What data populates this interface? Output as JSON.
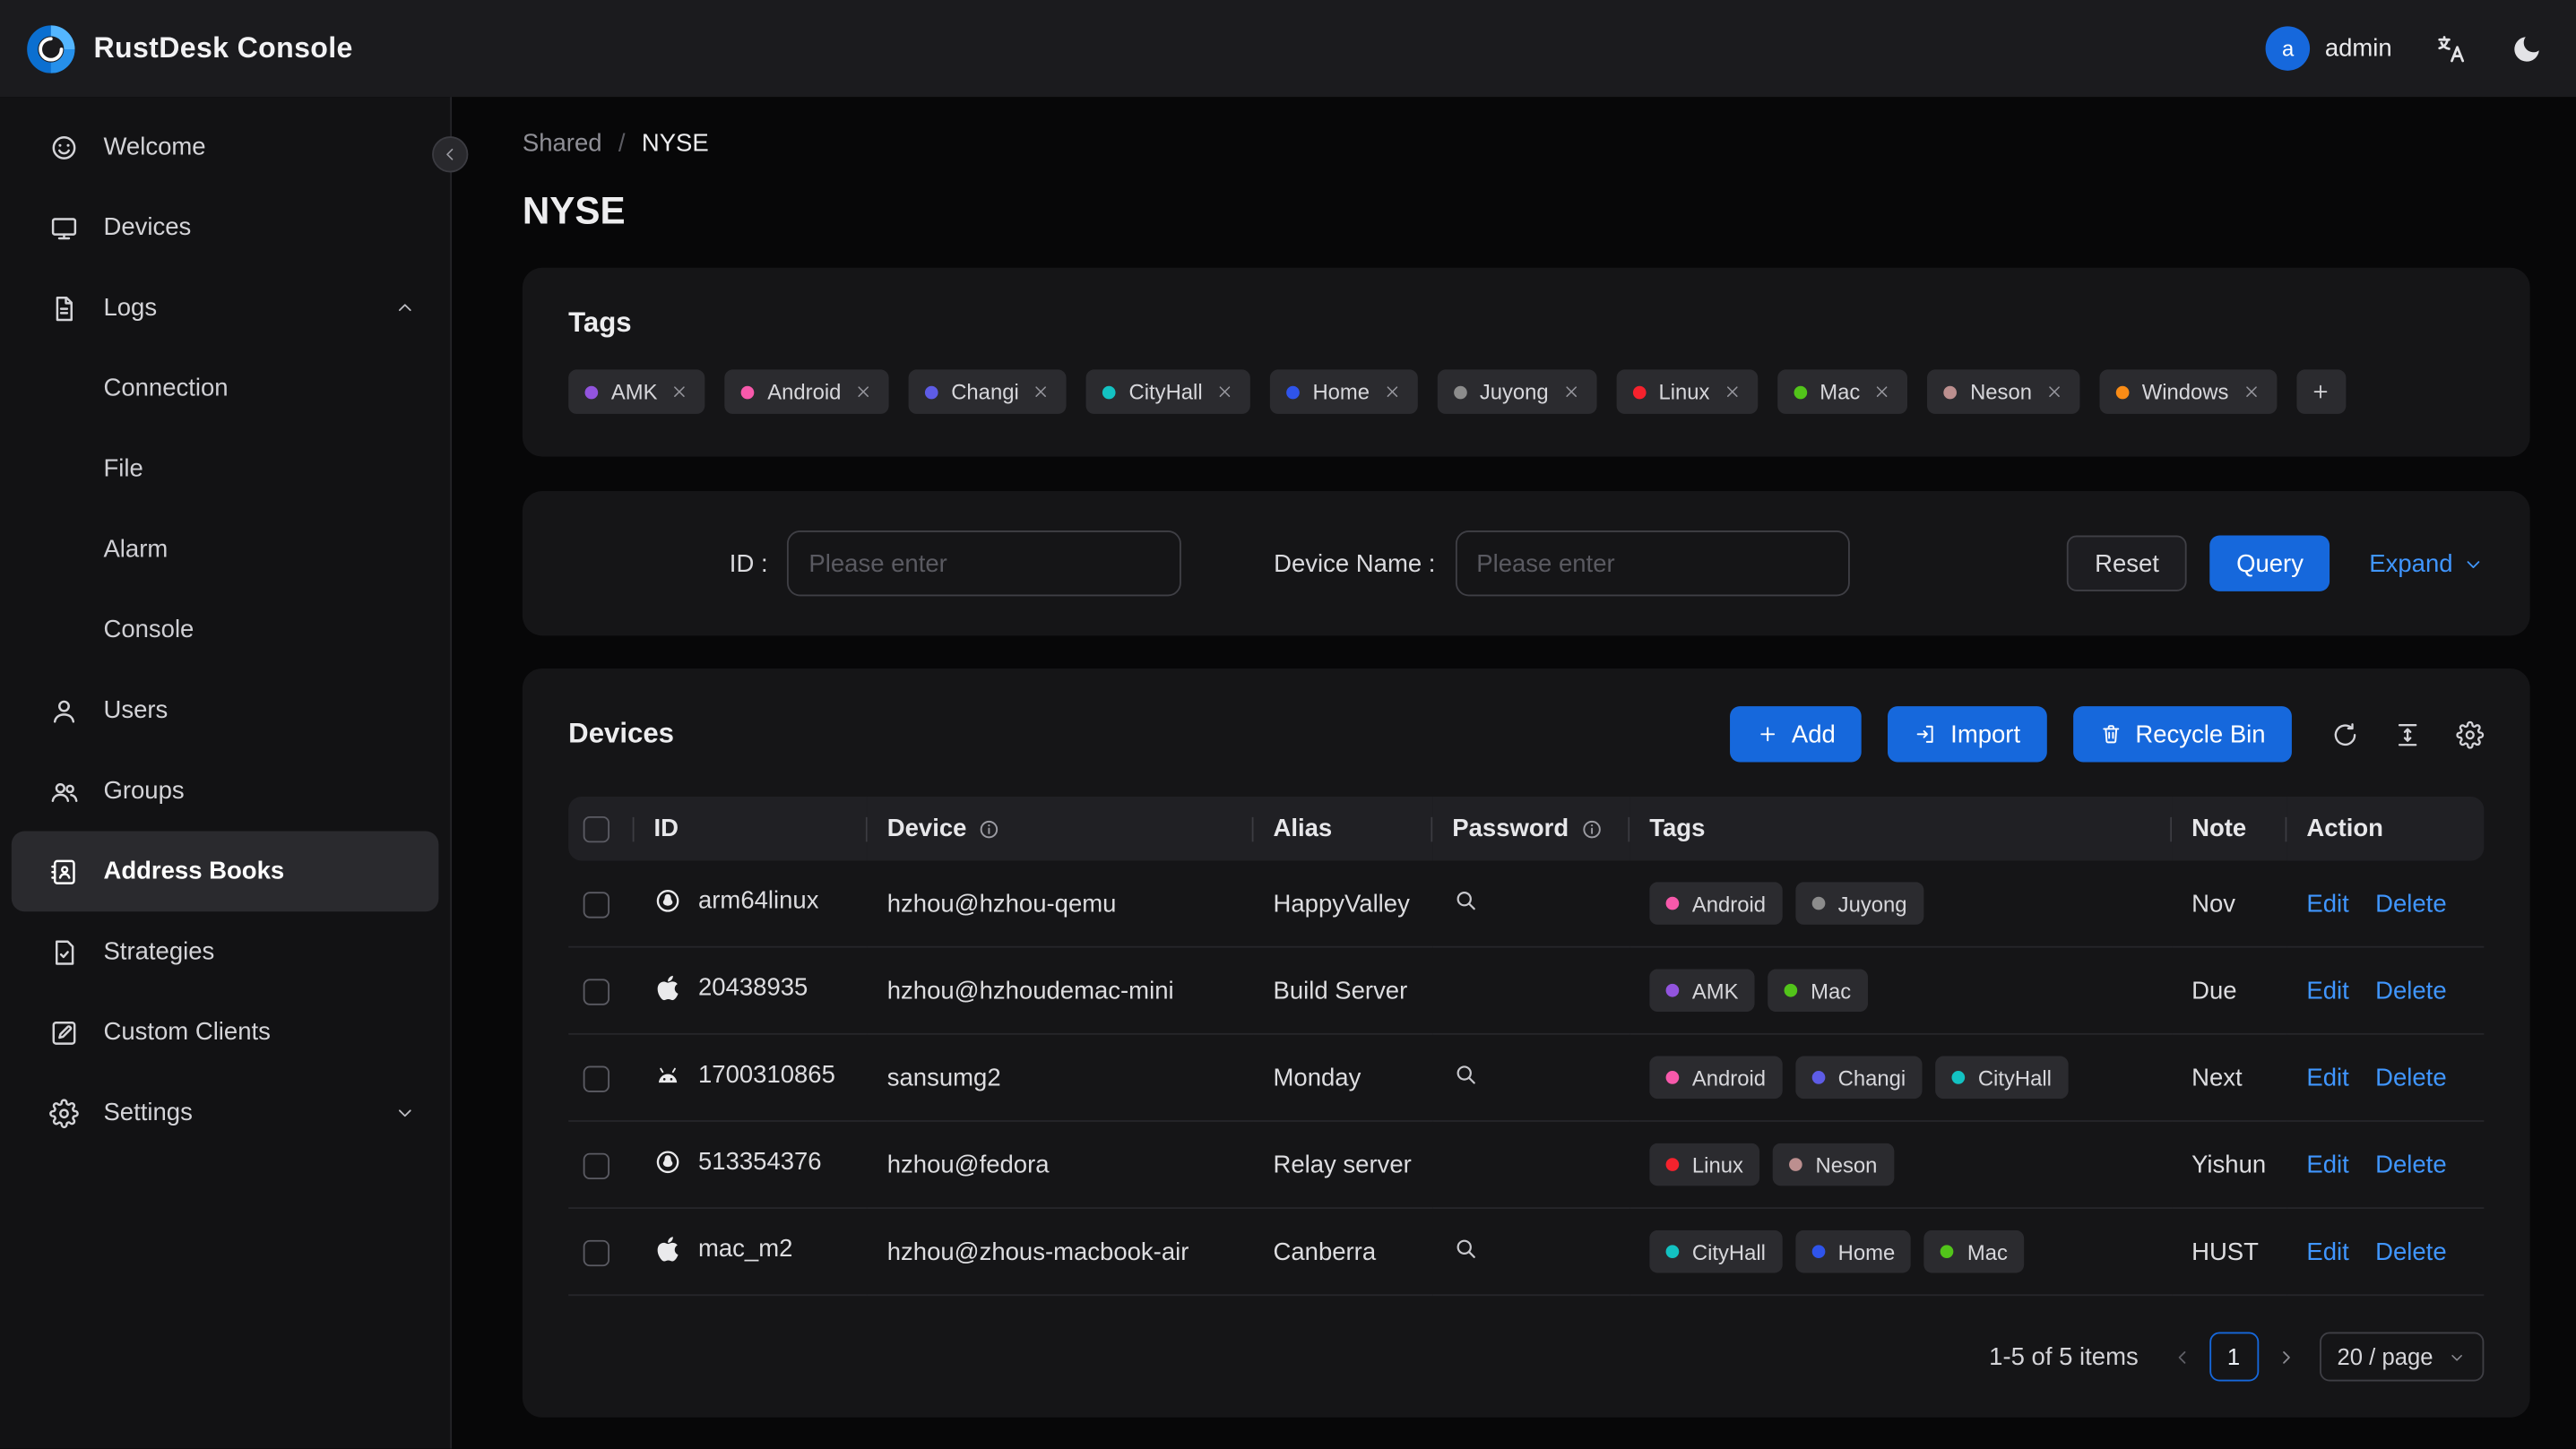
{
  "header": {
    "title": "RustDesk Console",
    "avatar_initial": "a",
    "username": "admin"
  },
  "sidebar": {
    "items": [
      {
        "label": "Welcome",
        "icon": "smiley"
      },
      {
        "label": "Devices",
        "icon": "monitor"
      },
      {
        "label": "Logs",
        "icon": "file-text",
        "expanded": true,
        "children": [
          {
            "label": "Connection"
          },
          {
            "label": "File"
          },
          {
            "label": "Alarm"
          },
          {
            "label": "Console"
          }
        ]
      },
      {
        "label": "Users",
        "icon": "user"
      },
      {
        "label": "Groups",
        "icon": "team"
      },
      {
        "label": "Address Books",
        "icon": "address-book",
        "active": true
      },
      {
        "label": "Strategies",
        "icon": "strategy"
      },
      {
        "label": "Custom Clients",
        "icon": "edit-square"
      },
      {
        "label": "Settings",
        "icon": "gear",
        "collapsed": true
      }
    ]
  },
  "breadcrumb": {
    "parent": "Shared",
    "separator": "/",
    "current": "NYSE"
  },
  "page_title": "NYSE",
  "tags_card": {
    "title": "Tags",
    "tags": [
      {
        "label": "AMK",
        "color": "#9254de"
      },
      {
        "label": "Android",
        "color": "#f759ab"
      },
      {
        "label": "Changi",
        "color": "#5e5ce6"
      },
      {
        "label": "CityHall",
        "color": "#13c2c2"
      },
      {
        "label": "Home",
        "color": "#2f54eb"
      },
      {
        "label": "Juyong",
        "color": "#8c8c8c"
      },
      {
        "label": "Linux",
        "color": "#f5222d"
      },
      {
        "label": "Mac",
        "color": "#52c41a"
      },
      {
        "label": "Neson",
        "color": "#bc8f8f"
      },
      {
        "label": "Windows",
        "color": "#fa8c16"
      }
    ]
  },
  "filter": {
    "fields": [
      {
        "label": "ID :",
        "placeholder": "Please enter"
      },
      {
        "label": "Device Name :",
        "placeholder": "Please enter"
      }
    ],
    "reset_label": "Reset",
    "query_label": "Query",
    "expand_label": "Expand"
  },
  "devices_card": {
    "title": "Devices",
    "toolbar": {
      "add": "Add",
      "import": "Import",
      "recycle_bin": "Recycle Bin"
    },
    "columns": [
      {
        "label": "ID"
      },
      {
        "label": "Device",
        "info": true
      },
      {
        "label": "Alias"
      },
      {
        "label": "Password",
        "info": true
      },
      {
        "label": "Tags"
      },
      {
        "label": "Note"
      },
      {
        "label": "Action"
      }
    ],
    "rows": [
      {
        "os": "linux",
        "id": "arm64linux",
        "device": "hzhou@hzhou-qemu",
        "alias": "HappyValley",
        "has_password": true,
        "tags": [
          "Android",
          "Juyong"
        ],
        "note": "Nov"
      },
      {
        "os": "apple",
        "id": "20438935",
        "device": "hzhou@hzhoudemac-mini",
        "alias": "Build Server",
        "has_password": false,
        "tags": [
          "AMK",
          "Mac"
        ],
        "note": "Due"
      },
      {
        "os": "android",
        "id": "1700310865",
        "device": "sansumg2",
        "alias": "Monday",
        "has_password": true,
        "tags": [
          "Android",
          "Changi",
          "CityHall"
        ],
        "note": "Next"
      },
      {
        "os": "linux",
        "id": "513354376",
        "device": "hzhou@fedora",
        "alias": "Relay server",
        "has_password": false,
        "tags": [
          "Linux",
          "Neson"
        ],
        "note": "Yishun"
      },
      {
        "os": "apple",
        "id": "mac_m2",
        "device": "hzhou@zhous-macbook-air",
        "alias": "Canberra",
        "has_password": true,
        "tags": [
          "CityHall",
          "Home",
          "Mac"
        ],
        "note": "HUST"
      }
    ],
    "actions": {
      "edit": "Edit",
      "delete": "Delete"
    },
    "pagination": {
      "summary": "1-5 of 5 items",
      "current_page": "1",
      "page_size": "20 / page"
    }
  },
  "accent_colors": {
    "primary_blue": "#1668dc",
    "link_blue": "#4096ff"
  }
}
